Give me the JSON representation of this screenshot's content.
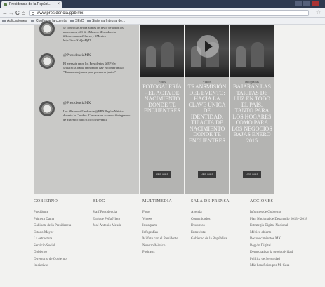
{
  "browser": {
    "tab_title": "Presidencia de la Repúbl...",
    "tab_close": "×",
    "back": "←",
    "forward": "→",
    "reload": "C",
    "home": "⌂",
    "url": "www.presidencia.gob.mx",
    "star": "☆",
    "bookmarks": [
      "Aplicaciones",
      "Confirmar la cuenta",
      "SEyD",
      "Sistema Integral de..."
    ]
  },
  "tweets": [
    {
      "handle": "",
      "text": "@ convocan ayuda al mes en favor de todos los mexicanos, al 1 de #Mexico #Presidencia #Gobernamos #Nuevo y #Mexico http://t.co/XkQwHjTl"
    },
    {
      "handle": "@PresidenciaMX",
      "text": "El mensaje entre los Presidentes @EPN y @BarackObama en nombre hay el compromiso \"Trabajando juntos para prosperar juntos\""
    },
    {
      "handle": "@PresidenciaMX",
      "text": "Los #Estados#Unidos de @EPN llegó a México durante la Cumbre. Conozca un acuerdo #Integrando de #Mexico http://t.co/xlwlbvbpg4"
    }
  ],
  "cards": [
    {
      "category": "Fotos",
      "title": "Fotogalería - El Acta de Nacimiento Donde Te Encuentres",
      "button": "VER MÁS"
    },
    {
      "category": "Videos",
      "title": "Transmisión del Evento: Hacia la Clave Única de Identidad: Tu Acta de Nacimiento Donde Te Encuentres",
      "button": "VER MÁS"
    },
    {
      "category": "Infografías",
      "title": "Bajarán las Tarifas de Luz en Todo el País, Tanto para los Hogares Como para los Negocios Bajas enero 2015",
      "button": "VER MÁS"
    }
  ],
  "footer": {
    "columns": [
      {
        "title": "Gobierno",
        "links": [
          "Presidente",
          "Primera Dama",
          "Gabinete de la Presidencia",
          "Estado Mayor",
          "La estructura",
          "Servicio Social",
          "Gobierno",
          "Directorio de Gobierno",
          "Iniciativas"
        ]
      },
      {
        "title": "Blog",
        "links": [
          "Staff Presidencia",
          "Enrique Peña Nieto",
          "José Antonio Meade"
        ]
      },
      {
        "title": "Multimedia",
        "links": [
          "Fotos",
          "Videos",
          "Instagram",
          "Infografías",
          "Mi foto con el Presidente",
          "Nuestro México",
          "Podcasts"
        ]
      },
      {
        "title": "Sala de Prensa",
        "links": [
          "Agenda",
          "Comunicados",
          "Discursos",
          "Entrevistas",
          "Gobierno de la República"
        ]
      },
      {
        "title": "Acciones",
        "links": [
          "Informes de Gobierno",
          "Plan Nacional de Desarrollo 2013 - 2018",
          "Estrategia Digital Nacional",
          "México abierto",
          "Reconocimientos MX",
          "Región Digital",
          "Democratizar la productividad",
          "Política de Seguridad",
          "Más beneficios por Mi Casa"
        ]
      }
    ]
  }
}
